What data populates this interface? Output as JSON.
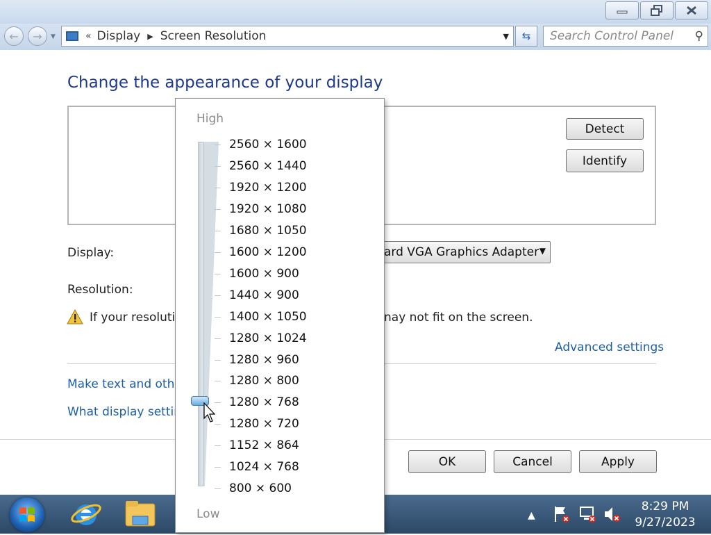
{
  "window": {
    "controls": {
      "minimize_icon": "minimize-icon",
      "maximize_icon": "restore-icon",
      "close_icon": "close-icon"
    }
  },
  "addressbar": {
    "overflow": "«",
    "breadcrumbs": [
      "Display",
      "Screen Resolution"
    ],
    "search_placeholder": "Search Control Panel"
  },
  "page": {
    "heading": "Change the appearance of your display",
    "detect_label": "Detect",
    "identify_label": "Identify",
    "display_label": "Display:",
    "display_value": "ard VGA Graphics Adapter",
    "resolution_label": "Resolution:",
    "warning_left": "If your resolutio",
    "warning_right": "nay not fit on the screen.",
    "advanced_link": "Advanced settings",
    "link_text_size": "Make text and othe",
    "link_display_settings": "What display setting",
    "ok_label": "OK",
    "cancel_label": "Cancel",
    "apply_label": "Apply"
  },
  "resolution_popup": {
    "high_label": "High",
    "low_label": "Low",
    "options": [
      "2560 × 1600",
      "2560 × 1440",
      "1920 × 1200",
      "1920 × 1080",
      "1680 × 1050",
      "1600 × 1200",
      "1600 × 900",
      "1440 × 900",
      "1400 × 1050",
      "1280 × 1024",
      "1280 × 960",
      "1280 × 800",
      "1280 × 768",
      "1280 × 720",
      "1152 × 864",
      "1024 × 768",
      "800 × 600"
    ],
    "selected": "1280 × 768"
  },
  "taskbar": {
    "apps": [
      "internet-explorer-icon",
      "windows-explorer-icon"
    ],
    "tray_icons": [
      "show-hidden-icons-arrow",
      "action-center-flag-icon",
      "network-icon",
      "volume-muted-icon"
    ],
    "time": "8:29 PM",
    "date": "9/27/2023"
  },
  "colors": {
    "heading": "#1e3a8a",
    "link": "#1c5fa8",
    "taskbar": "#2c4866"
  }
}
